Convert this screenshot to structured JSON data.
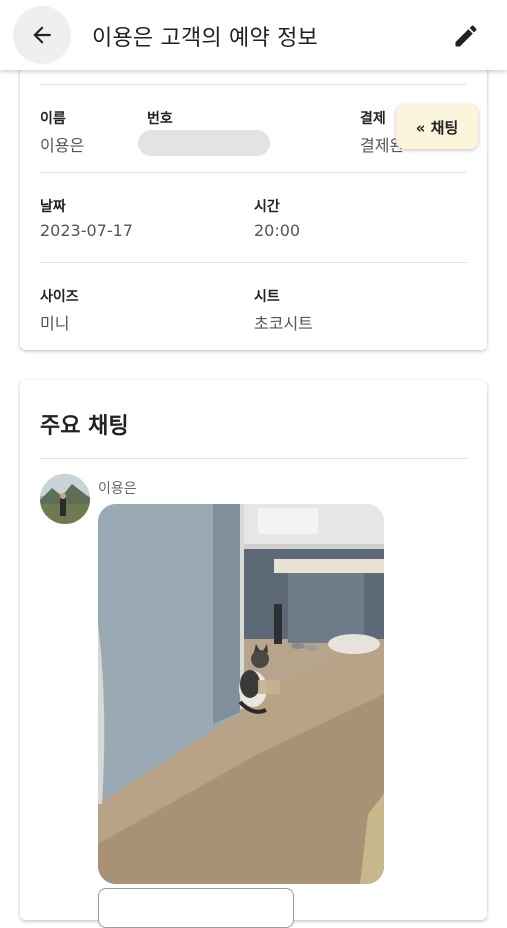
{
  "header": {
    "title": "이용은 고객의 예약 정보",
    "back_icon": "arrow-left-icon",
    "edit_icon": "pencil-icon"
  },
  "info": {
    "name_label": "이름",
    "name_value": "이용은",
    "phone_label": "번호",
    "payment_label": "결제",
    "payment_value": "결제완",
    "date_label": "날짜",
    "date_value": "2023-07-17",
    "time_label": "시간",
    "time_value": "20:00",
    "size_label": "사이즈",
    "size_value": "미니",
    "sheet_label": "시트",
    "sheet_value": "초코시트"
  },
  "chat_fab": {
    "label": "« 채팅"
  },
  "chat": {
    "title": "주요 채팅",
    "sender": "이용은"
  },
  "colors": {
    "fab_bg": "#fbf5dc",
    "divider": "#e2e2e2",
    "back_bg": "#efefef"
  }
}
